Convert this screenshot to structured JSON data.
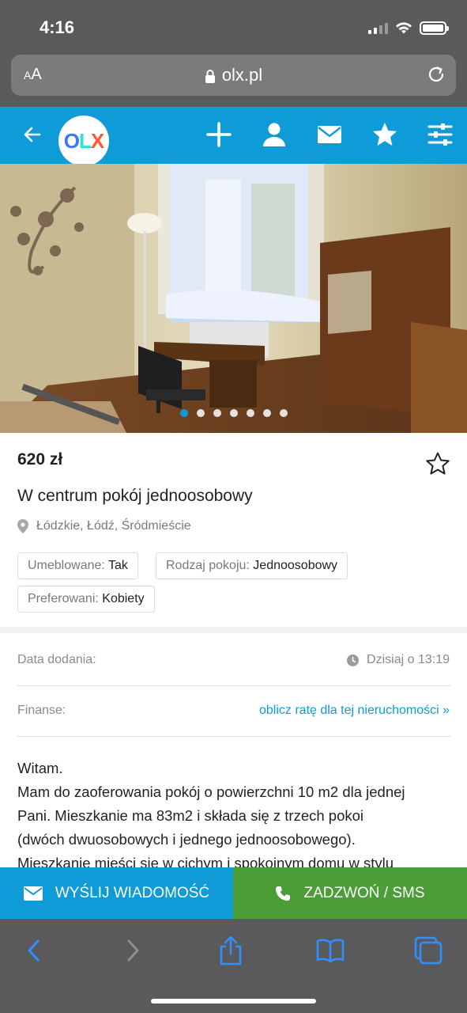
{
  "status": {
    "time": "4:16"
  },
  "browser": {
    "aa_label": "AA",
    "url": "olx.pl"
  },
  "header": {
    "logo_letters": {
      "o": "O",
      "l": "L",
      "x": "X"
    },
    "icons": [
      "back-arrow-icon",
      "plus-icon",
      "user-icon",
      "mail-icon",
      "star-icon",
      "filter-sliders-icon"
    ],
    "brand_color": "#0f9bd7"
  },
  "gallery": {
    "photo_count": 7,
    "active_index": 0
  },
  "listing": {
    "price": "620 zł",
    "title": "W centrum pokój jednoosobowy",
    "location": "Łódzkie, Łódź, Śródmieście",
    "tags": [
      {
        "label": "Umeblowane:",
        "value": "Tak"
      },
      {
        "label": "Rodzaj pokoju:",
        "value": "Jednoosobowy"
      },
      {
        "label": "Preferowani:",
        "value": "Kobiety"
      }
    ]
  },
  "details": {
    "date_label": "Data dodania:",
    "date_value": "Dzisiaj o 13:19",
    "finance_label": "Finanse:",
    "finance_link": "oblicz ratę dla tej nieruchomości »"
  },
  "description": {
    "lines": [
      "Witam.",
      "Mam do zaoferowania pokój o powierzchni 10 m2 dla jednej",
      "Pani. Mieszkanie ma 83m2 i składa się z trzech pokoi",
      "(dwóch dwuosobowych i jednego jednoosobowego).",
      "Mieszkanie mieści się w cichym i spokojnym domu w stylu"
    ]
  },
  "actions": {
    "message_label": "WYŚLIJ WIADOMOŚĆ",
    "call_label": "ZADZWOŃ / SMS",
    "message_color": "#0f9bd7",
    "call_color": "#4a9d37"
  },
  "toolbar": {
    "icons": [
      "back-icon",
      "forward-icon",
      "share-icon",
      "bookmarks-icon",
      "tabs-icon"
    ]
  }
}
